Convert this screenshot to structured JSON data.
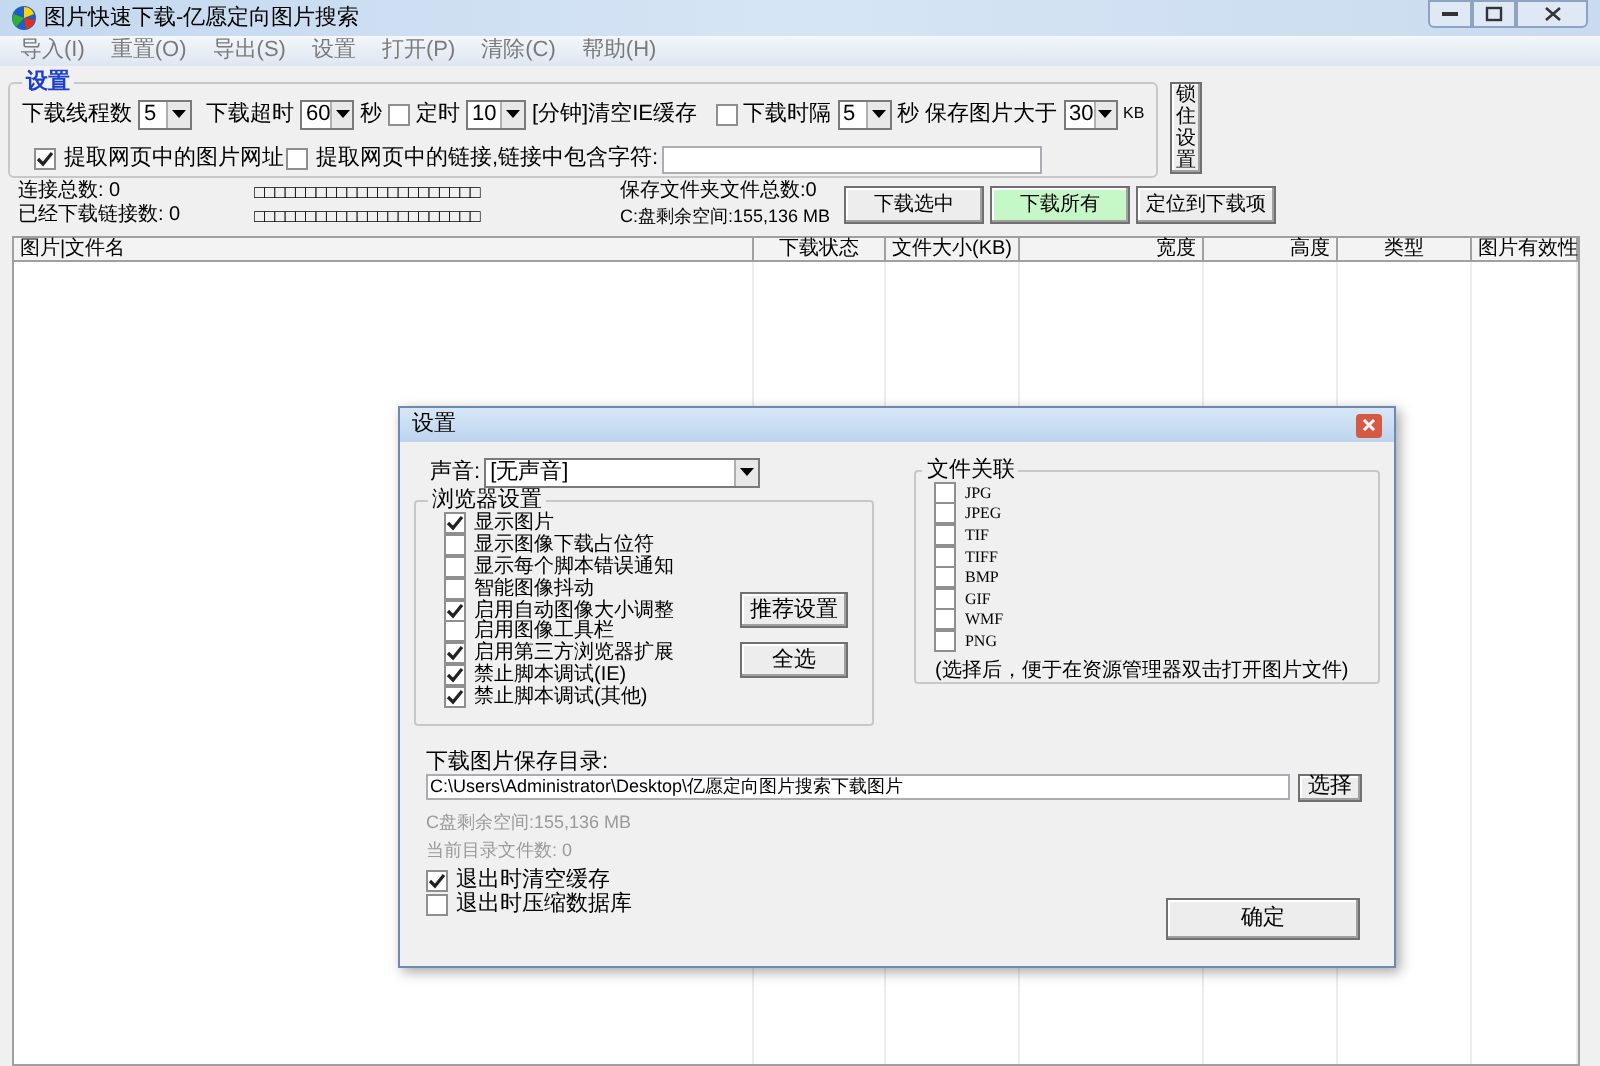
{
  "window": {
    "title": "图片快速下载-亿愿定向图片搜索"
  },
  "menu": [
    "导入(I)",
    "重置(O)",
    "导出(S)",
    "设置",
    "打开(P)",
    "清除(C)",
    "帮助(H)"
  ],
  "settings": {
    "title": "设置",
    "threads": {
      "label": "下载线程数",
      "value": "5"
    },
    "timeout": {
      "label": "下载超时",
      "value": "60",
      "unit": "秒"
    },
    "timer": {
      "checked": false,
      "label": "定时",
      "value": "10",
      "suffix": "[分钟]清空IE缓存"
    },
    "interval": {
      "checked": false,
      "label": "下载时隔",
      "value": "5",
      "unit": "秒"
    },
    "min_size": {
      "label": "保存图片大于",
      "value": "30",
      "unit": "KB"
    },
    "extract_images": {
      "checked": true,
      "label": "提取网页中的图片网址"
    },
    "extract_links": {
      "checked": false,
      "label": "提取网页中的链接,链接中包含字符:"
    },
    "lock_button": "锁住设置"
  },
  "stats": {
    "connections": "连接总数: 0",
    "downloaded": "已经下载链接数: 0",
    "boxes_1": "□□□□□□□□□□□□□□□□□□□□□□",
    "boxes_2": "□□□□□□□□□□□□□□□□□□□□□□",
    "folder_total": "保存文件夹文件总数:0",
    "disk_space": "C:盘剩余空间:155,136 MB"
  },
  "buttons": [
    {
      "label": "下载选中",
      "highlighted": false
    },
    {
      "label": "下载所有",
      "highlighted": true
    },
    {
      "label": "定位到下载项",
      "highlighted": false
    }
  ],
  "table": {
    "columns": [
      "图片|文件名",
      "下载状态",
      "文件大小(KB)",
      "宽度",
      "高度",
      "类型",
      "图片有效性"
    ]
  },
  "dialog": {
    "title": "设置",
    "sound": {
      "label": "声音:",
      "value": "[无声音]"
    },
    "browser_group": {
      "title": "浏览器设置",
      "items": [
        {
          "label": "显示图片",
          "checked": true
        },
        {
          "label": "显示图像下载占位符",
          "checked": false
        },
        {
          "label": "显示每个脚本错误通知",
          "checked": false
        },
        {
          "label": "智能图像抖动",
          "checked": false
        },
        {
          "label": "启用自动图像大小调整",
          "checked": true
        },
        {
          "label": "启用图像工具栏",
          "checked": false
        },
        {
          "label": "启用第三方浏览器扩展",
          "checked": true
        },
        {
          "label": "禁止脚本调试(IE)",
          "checked": true
        },
        {
          "label": "禁止脚本调试(其他)",
          "checked": true
        }
      ],
      "buttons": [
        "推荐设置",
        "全选"
      ]
    },
    "file_group": {
      "title": "文件关联",
      "items": [
        {
          "label": "JPG",
          "checked": false
        },
        {
          "label": "JPEG",
          "checked": false
        },
        {
          "label": "TIF",
          "checked": false
        },
        {
          "label": "TIFF",
          "checked": false
        },
        {
          "label": "BMP",
          "checked": false
        },
        {
          "label": "GIF",
          "checked": false
        },
        {
          "label": "WMF",
          "checked": false
        },
        {
          "label": "PNG",
          "checked": false
        }
      ],
      "note": "(选择后，便于在资源管理器双击打开图片文件)"
    },
    "save_dir": {
      "label": "下载图片保存目录:",
      "value": "C:\\Users\\Administrator\\Desktop\\亿愿定向图片搜索下载图片",
      "button": "选择"
    },
    "disk_space": "C盘剩余空间:155,136 MB",
    "file_count": "当前目录文件数: 0",
    "exit_options": [
      {
        "label": "退出时清空缓存",
        "checked": true
      },
      {
        "label": "退出时压缩数据库",
        "checked": false
      }
    ],
    "ok_button": "确定"
  }
}
